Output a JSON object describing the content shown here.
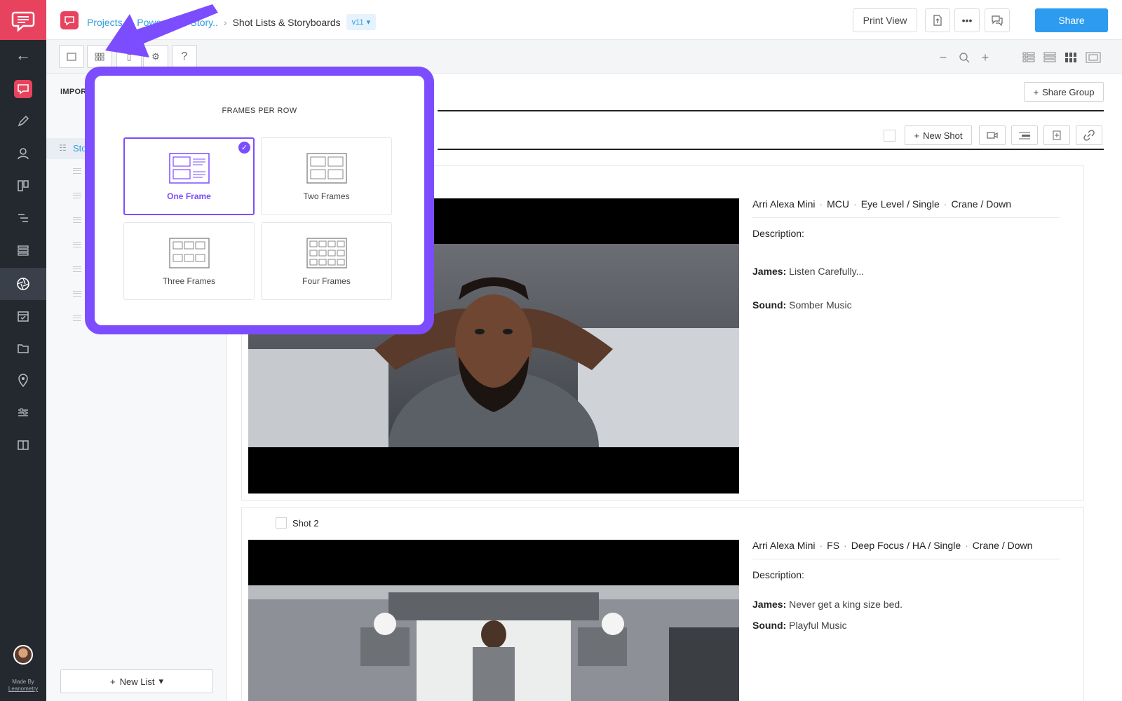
{
  "breadcrumb": {
    "projects": "Projects",
    "project": "Power Rule Story..",
    "current": "Shot Lists & Storyboards",
    "version": "v11"
  },
  "topbar": {
    "print_view": "Print View",
    "share": "Share"
  },
  "rail": {
    "credit_line1": "Made By",
    "credit_line2": "Leanometry"
  },
  "sidebar": {
    "import_label": "IMPORT",
    "active_item": "Sto",
    "new_list": "New List"
  },
  "main": {
    "share_group": "Share Group",
    "new_shot": "New Shot"
  },
  "popup": {
    "title": "FRAMES PER ROW",
    "options": [
      {
        "label": "One Frame",
        "selected": true
      },
      {
        "label": "Two Frames",
        "selected": false
      },
      {
        "label": "Three Frames",
        "selected": false
      },
      {
        "label": "Four Frames",
        "selected": false
      }
    ]
  },
  "shots": [
    {
      "title": "",
      "camera": "Arri Alexa Mini",
      "size": "MCU",
      "angle": "Eye Level / Single",
      "movement": "Crane / Down",
      "description_label": "Description:",
      "character": "James:",
      "dialogue": "Listen Carefully...",
      "sound_label": "Sound:",
      "sound": "Somber Music"
    },
    {
      "title": "Shot 2",
      "camera": "Arri Alexa Mini",
      "size": "FS",
      "angle": "Deep Focus / HA / Single",
      "movement": "Crane / Down",
      "description_label": "Description:",
      "character": "James:",
      "dialogue": "Never get a king size bed.",
      "sound_label": "Sound:",
      "sound": "Playful Music"
    }
  ],
  "colors": {
    "accent_purple": "#7c4dff",
    "brand_pink": "#e8435e",
    "link_blue": "#2f9be0",
    "share_blue": "#2d9cf0",
    "rail_dark": "#24292f"
  }
}
